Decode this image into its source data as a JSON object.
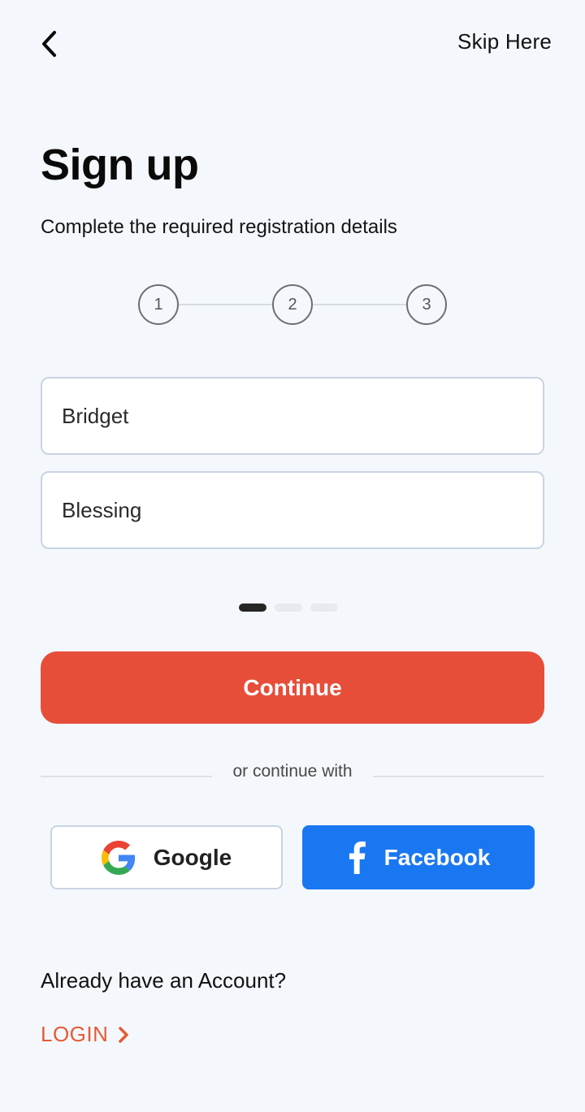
{
  "header": {
    "back_icon": "chevron-left-icon",
    "skip_label": "Skip Here"
  },
  "title": "Sign up",
  "subtitle": "Complete the required registration details",
  "stepper": {
    "steps": [
      "1",
      "2",
      "3"
    ]
  },
  "form": {
    "first_name_value": "Bridget",
    "last_name_value": "Blessing"
  },
  "pagination": {
    "total": 3,
    "active_index": 0
  },
  "continue_label": "Continue",
  "divider_text": "or continue with",
  "social": {
    "google_label": "Google",
    "google_icon": "google-icon",
    "facebook_label": "Facebook",
    "facebook_icon": "facebook-icon"
  },
  "footer": {
    "already_text": "Already have an Account?",
    "login_label": "LOGIN",
    "login_icon": "chevron-right-icon"
  },
  "colors": {
    "background": "#f4f8fc",
    "primary": "#e64e3a",
    "facebook": "#1a77f2",
    "login_accent": "#e65a34"
  }
}
